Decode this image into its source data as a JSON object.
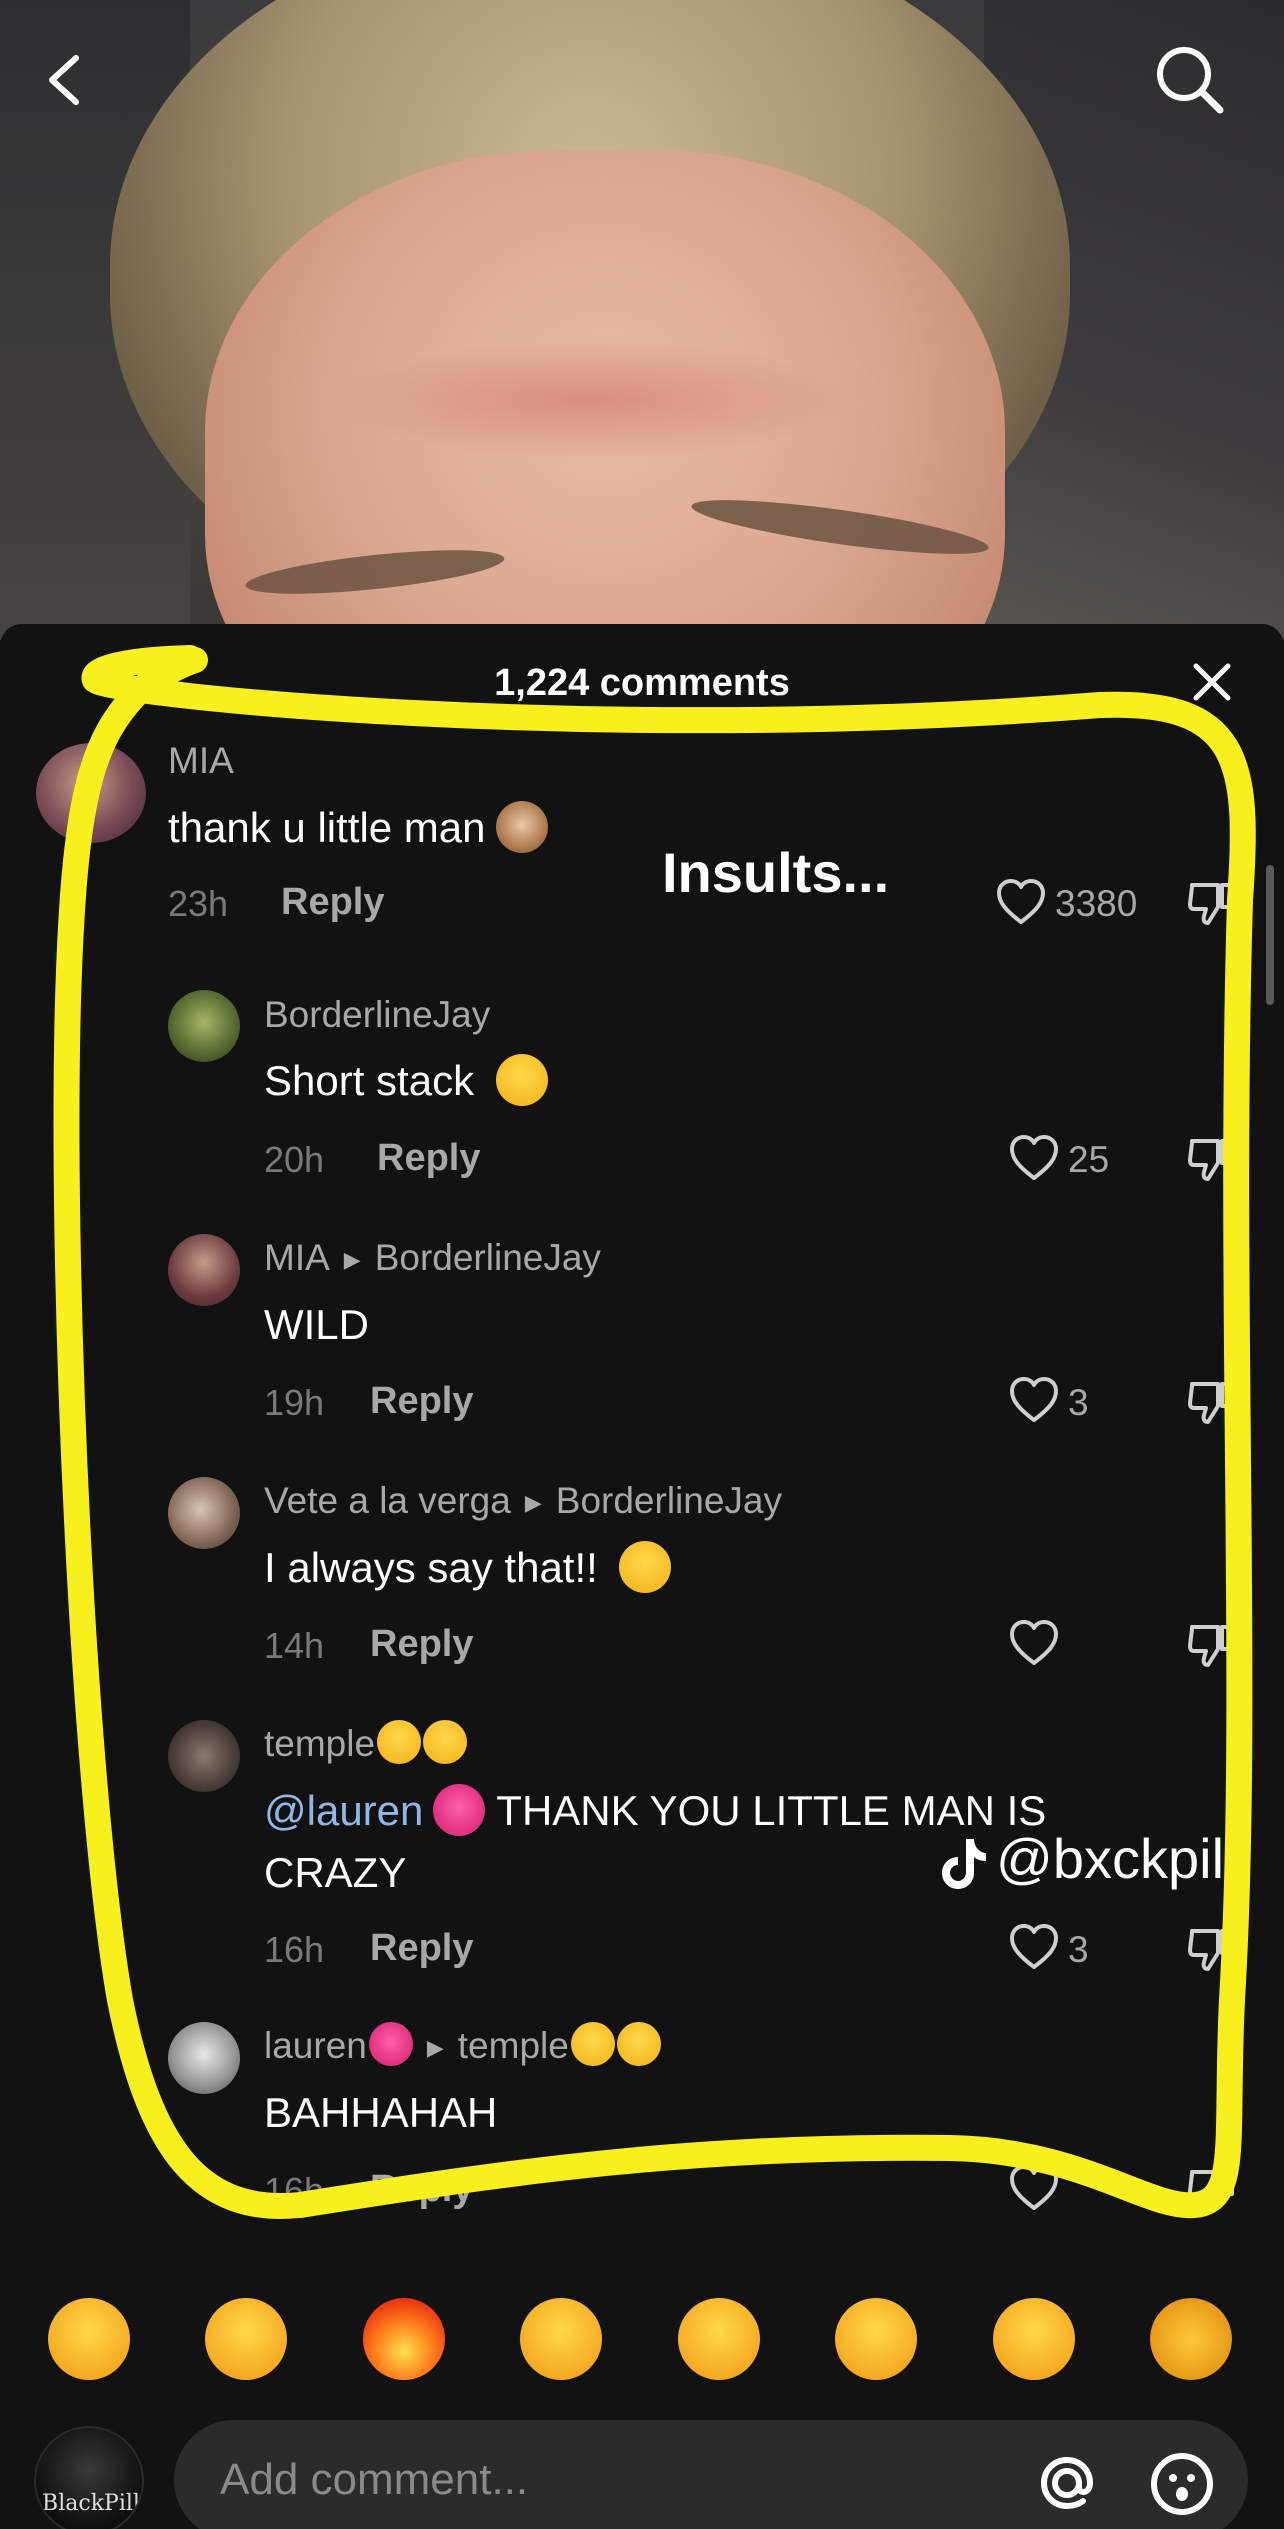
{
  "nav": {
    "back_icon": "back-chevron-icon",
    "search_icon": "search-icon"
  },
  "sheet": {
    "title": "1,224 comments",
    "close_icon": "close-icon"
  },
  "overlay": {
    "label": "Insults...",
    "watermark": "@bxckpill"
  },
  "colors": {
    "highlight": "#f7f01c",
    "mention": "#8fb8e6",
    "background": "#121212"
  },
  "comments": [
    {
      "username": "MIA",
      "text": "thank u little man",
      "text_emoji": "see-no-evil-monkey",
      "time": "23h",
      "reply": "Reply",
      "likes": "3380"
    },
    {
      "username": "BorderlineJay",
      "text": "Short stack ",
      "text_emoji": "winking-tongue-face",
      "time": "20h",
      "reply": "Reply",
      "likes": "25"
    },
    {
      "username": "MIA",
      "reply_to": "BorderlineJay",
      "text": "WILD",
      "time": "19h",
      "reply": "Reply",
      "likes": "3"
    },
    {
      "username": "Vete a la verga",
      "reply_to": "BorderlineJay",
      "text": "I always say that!! ",
      "text_emoji": "rolling-laughing-face",
      "time": "14h",
      "reply": "Reply",
      "likes": ""
    },
    {
      "username": "temple",
      "username_emoji": "smiling-face x2",
      "mention": "@lauren",
      "text_line1": " THANK YOU LITTLE MAN IS",
      "text_line2": "CRAZY",
      "time": "16h",
      "reply": "Reply",
      "likes": "3"
    },
    {
      "username": "lauren",
      "username_emoji": "heart-with-ribbon",
      "reply_to": "temple",
      "text": "BAHHAHAH",
      "time": "16h",
      "reply": "Reply",
      "likes": ""
    }
  ],
  "quick_emojis": [
    "tears-of-joy",
    "rolling-laughing",
    "fire",
    "pensive",
    "thinking",
    "sunglasses",
    "raised-eyebrow",
    "handshake"
  ],
  "composer": {
    "placeholder": "Add comment...",
    "avatar_text": "BlackPill",
    "at_icon": "at-icon",
    "emoji_icon": "emoji-icon"
  }
}
